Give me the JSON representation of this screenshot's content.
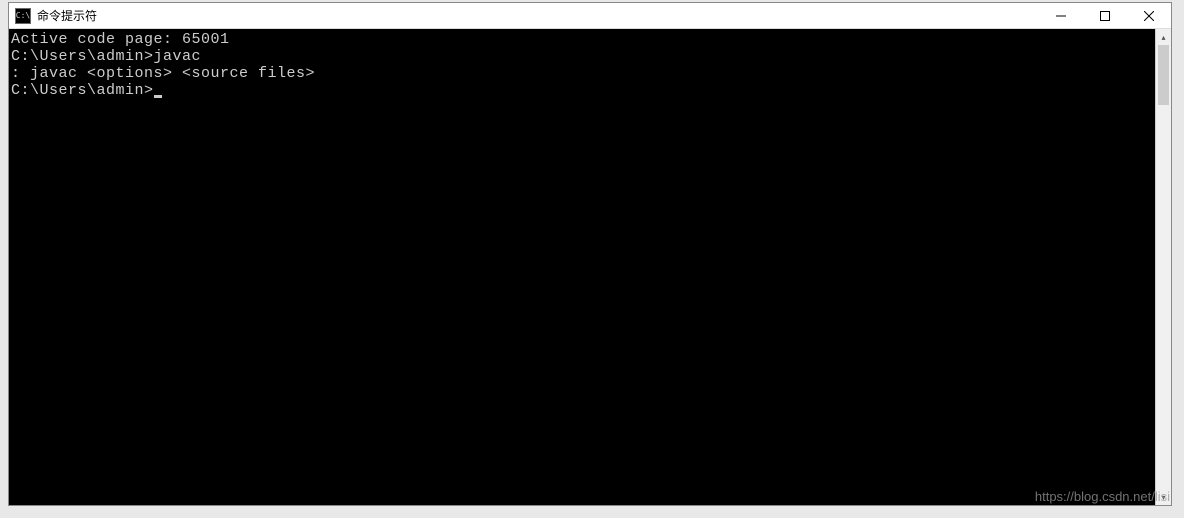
{
  "window": {
    "title": "命令提示符",
    "icon_label": "C:\\"
  },
  "terminal": {
    "lines": [
      "Active code page: 65001",
      "",
      "C:\\Users\\admin>javac",
      ": javac <options> <source files>",
      "",
      "C:\\Users\\admin>"
    ],
    "prompt_prefix": "C:\\Users\\admin>",
    "last_command": "javac",
    "code_page": "65001"
  },
  "watermark": "https://blog.csdn.net/lisi"
}
